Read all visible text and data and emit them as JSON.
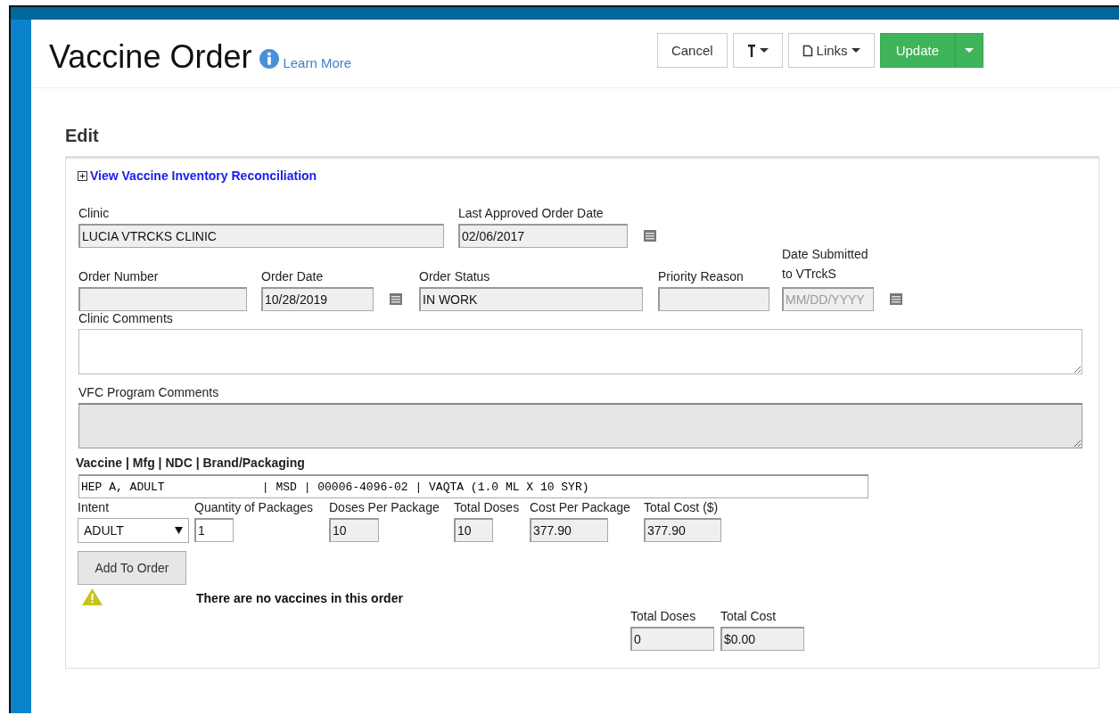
{
  "header": {
    "title": "Vaccine Order",
    "learn_more": "Learn More",
    "buttons": [
      {
        "kind": "cancel",
        "label": "Cancel"
      },
      {
        "kind": "pin"
      },
      {
        "kind": "links",
        "label": "Links"
      },
      {
        "kind": "update",
        "label": "Update"
      }
    ]
  },
  "section_title": "Edit",
  "reconciliation_link": {
    "label": "View Vaccine Inventory Reconciliation",
    "expanded": false
  },
  "order_fields": [
    [
      {
        "label": "Clinic",
        "value": "LUCIA VTRCKS CLINIC",
        "kind": "text",
        "disabled": true
      },
      {
        "label": "Last Approved Order Date",
        "value": "02/06/2017",
        "kind": "date",
        "disabled": true
      }
    ],
    [
      {
        "label": "Order Number",
        "kind": "text",
        "disabled": true
      },
      {
        "label": "Order Date",
        "value": "10/28/2019",
        "kind": "date",
        "disabled": true
      },
      {
        "label": "Order Status",
        "value": "IN WORK",
        "kind": "text",
        "disabled": true
      },
      {
        "label": "Priority Reason",
        "kind": "text",
        "disabled": true
      },
      {
        "label": "Date Submitted to VTrckS",
        "placeholder": "MM/DD/YYYY",
        "kind": "date",
        "disabled": true
      }
    ]
  ],
  "comments": [
    {
      "label": "Clinic Comments",
      "disabled": false
    },
    {
      "label": "VFC Program Comments",
      "disabled": true
    }
  ],
  "vaccine": {
    "label": "Vaccine | Mfg | NDC | Brand/Packaging",
    "value": "HEP A, ADULT              | MSD | 00006-4096-02 | VAQTA (1.0 ML X 10 SYR)"
  },
  "line_fields": [
    {
      "label": "Intent",
      "value": "ADULT",
      "kind": "select",
      "disabled": false
    },
    {
      "label": "Quantity of Packages",
      "value": "1",
      "kind": "text",
      "disabled": false
    },
    {
      "label": "Doses Per Package",
      "value": "10",
      "kind": "text",
      "disabled": true
    },
    {
      "label": "Total Doses",
      "value": "10",
      "kind": "text",
      "disabled": true
    },
    {
      "label": "Cost Per Package",
      "value": "377.90",
      "kind": "text",
      "disabled": true
    },
    {
      "label": "Total Cost ($)",
      "value": "377.90",
      "kind": "text",
      "disabled": true
    }
  ],
  "add_button": "Add To Order",
  "warning": "There are no vaccines in this order",
  "totals": [
    {
      "label": "Total Doses",
      "value": "0",
      "disabled": true
    },
    {
      "label": "Total Cost",
      "value": "$0.00",
      "disabled": true
    }
  ]
}
